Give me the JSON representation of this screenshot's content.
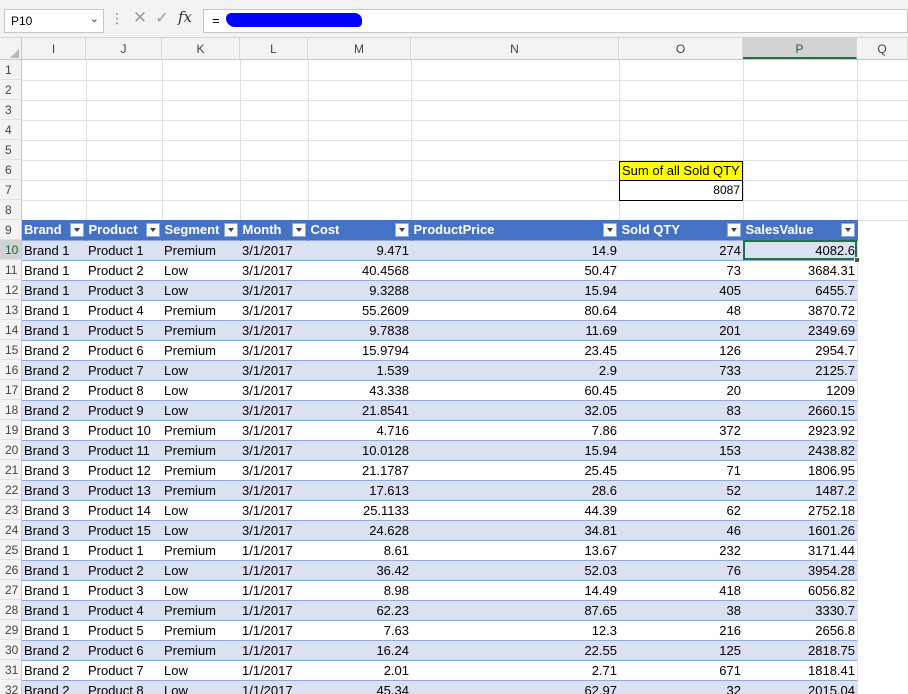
{
  "formula_bar": {
    "name_box": "P10",
    "formula": "=",
    "fx_label": "fx",
    "cancel_glyph": "✕",
    "enter_glyph": "✓"
  },
  "columns": [
    "I",
    "J",
    "K",
    "L",
    "M",
    "N",
    "O",
    "P",
    "Q"
  ],
  "selected_column": "P",
  "rows": [
    "1",
    "2",
    "3",
    "4",
    "5",
    "6",
    "7",
    "8",
    "9",
    "10",
    "11",
    "12",
    "13",
    "14",
    "15",
    "16",
    "17",
    "18",
    "19",
    "20",
    "21",
    "22",
    "23",
    "24",
    "25",
    "26",
    "27",
    "28",
    "29",
    "30",
    "31",
    "32"
  ],
  "selected_row": "10",
  "summary": {
    "label": "Sum of all Sold QTY",
    "value": "8087"
  },
  "table": {
    "headers": [
      "Brand",
      "Product",
      "Segment",
      "Month",
      "Cost",
      "ProductPrice",
      "Sold QTY",
      "SalesValue"
    ],
    "rows": [
      [
        "Brand 1",
        "Product 1",
        "Premium",
        "3/1/2017",
        "9.471",
        "14.9",
        "274",
        "4082.6"
      ],
      [
        "Brand 1",
        "Product 2",
        "Low",
        "3/1/2017",
        "40.4568",
        "50.47",
        "73",
        "3684.31"
      ],
      [
        "Brand 1",
        "Product 3",
        "Low",
        "3/1/2017",
        "9.3288",
        "15.94",
        "405",
        "6455.7"
      ],
      [
        "Brand 1",
        "Product 4",
        "Premium",
        "3/1/2017",
        "55.2609",
        "80.64",
        "48",
        "3870.72"
      ],
      [
        "Brand 1",
        "Product 5",
        "Premium",
        "3/1/2017",
        "9.7838",
        "11.69",
        "201",
        "2349.69"
      ],
      [
        "Brand 2",
        "Product 6",
        "Premium",
        "3/1/2017",
        "15.9794",
        "23.45",
        "126",
        "2954.7"
      ],
      [
        "Brand 2",
        "Product 7",
        "Low",
        "3/1/2017",
        "1.539",
        "2.9",
        "733",
        "2125.7"
      ],
      [
        "Brand 2",
        "Product 8",
        "Low",
        "3/1/2017",
        "43.338",
        "60.45",
        "20",
        "1209"
      ],
      [
        "Brand 2",
        "Product 9",
        "Low",
        "3/1/2017",
        "21.8541",
        "32.05",
        "83",
        "2660.15"
      ],
      [
        "Brand 3",
        "Product 10",
        "Premium",
        "3/1/2017",
        "4.716",
        "7.86",
        "372",
        "2923.92"
      ],
      [
        "Brand 3",
        "Product 11",
        "Premium",
        "3/1/2017",
        "10.0128",
        "15.94",
        "153",
        "2438.82"
      ],
      [
        "Brand 3",
        "Product 12",
        "Premium",
        "3/1/2017",
        "21.1787",
        "25.45",
        "71",
        "1806.95"
      ],
      [
        "Brand 3",
        "Product 13",
        "Premium",
        "3/1/2017",
        "17.613",
        "28.6",
        "52",
        "1487.2"
      ],
      [
        "Brand 3",
        "Product 14",
        "Low",
        "3/1/2017",
        "25.1133",
        "44.39",
        "62",
        "2752.18"
      ],
      [
        "Brand 3",
        "Product 15",
        "Low",
        "3/1/2017",
        "24.628",
        "34.81",
        "46",
        "1601.26"
      ],
      [
        "Brand 1",
        "Product 1",
        "Premium",
        "1/1/2017",
        "8.61",
        "13.67",
        "232",
        "3171.44"
      ],
      [
        "Brand 1",
        "Product 2",
        "Low",
        "1/1/2017",
        "36.42",
        "52.03",
        "76",
        "3954.28"
      ],
      [
        "Brand 1",
        "Product 3",
        "Low",
        "1/1/2017",
        "8.98",
        "14.49",
        "418",
        "6056.82"
      ],
      [
        "Brand 1",
        "Product 4",
        "Premium",
        "1/1/2017",
        "62.23",
        "87.65",
        "38",
        "3330.7"
      ],
      [
        "Brand 1",
        "Product 5",
        "Premium",
        "1/1/2017",
        "7.63",
        "12.3",
        "216",
        "2656.8"
      ],
      [
        "Brand 2",
        "Product 6",
        "Premium",
        "1/1/2017",
        "16.24",
        "22.55",
        "125",
        "2818.75"
      ],
      [
        "Brand 2",
        "Product 7",
        "Low",
        "1/1/2017",
        "2.01",
        "2.71",
        "671",
        "1818.41"
      ],
      [
        "Brand 2",
        "Product 8",
        "Low",
        "1/1/2017",
        "45.34",
        "62.97",
        "32",
        "2015.04"
      ]
    ]
  },
  "colors": {
    "header_blue": "#4472c4",
    "band_blue": "#d9e1f2",
    "highlight_yellow": "#ffff00",
    "selection_green": "#217346",
    "redaction_blue": "#0000ff"
  }
}
